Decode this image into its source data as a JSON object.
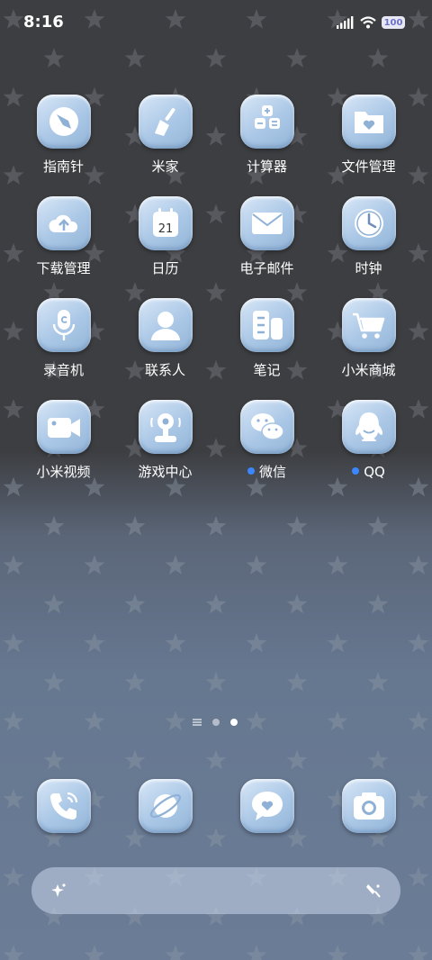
{
  "status_bar": {
    "time": "8:16",
    "battery": "100"
  },
  "apps": [
    {
      "id": "compass",
      "label": "指南针",
      "icon": "compass-icon"
    },
    {
      "id": "mi-home",
      "label": "米家",
      "icon": "broom-icon"
    },
    {
      "id": "calculator",
      "label": "计算器",
      "icon": "calculator-icon"
    },
    {
      "id": "file-manager",
      "label": "文件管理",
      "icon": "folder-heart-icon"
    },
    {
      "id": "downloads",
      "label": "下载管理",
      "icon": "cloud-upload-icon"
    },
    {
      "id": "calendar",
      "label": "日历",
      "icon": "calendar-icon",
      "badge_text": "21"
    },
    {
      "id": "email",
      "label": "电子邮件",
      "icon": "envelope-icon"
    },
    {
      "id": "clock",
      "label": "时钟",
      "icon": "clock-icon"
    },
    {
      "id": "recorder",
      "label": "录音机",
      "icon": "microphone-icon"
    },
    {
      "id": "contacts",
      "label": "联系人",
      "icon": "person-icon"
    },
    {
      "id": "notes",
      "label": "笔记",
      "icon": "notes-icon"
    },
    {
      "id": "mi-store",
      "label": "小米商城",
      "icon": "cart-icon"
    },
    {
      "id": "mi-video",
      "label": "小米视频",
      "icon": "video-camera-icon"
    },
    {
      "id": "game-center",
      "label": "游戏中心",
      "icon": "joystick-icon"
    },
    {
      "id": "wechat",
      "label": "微信",
      "icon": "wechat-icon",
      "new_dot": true
    },
    {
      "id": "qq",
      "label": "QQ",
      "icon": "penguin-icon",
      "new_dot": true
    }
  ],
  "pager": {
    "pages": 2,
    "active": 2
  },
  "dock": [
    {
      "id": "phone",
      "icon": "phone-icon"
    },
    {
      "id": "browser",
      "icon": "planet-icon"
    },
    {
      "id": "messages",
      "icon": "chat-heart-icon"
    },
    {
      "id": "camera",
      "icon": "camera-icon"
    }
  ],
  "search_bar": {
    "left_icon": "sparkle-icon",
    "right_icon": "voice-icon"
  },
  "colors": {
    "label": "#ffffff",
    "new_dot": "#3a87ff",
    "icon_fill": "#ffffff"
  }
}
